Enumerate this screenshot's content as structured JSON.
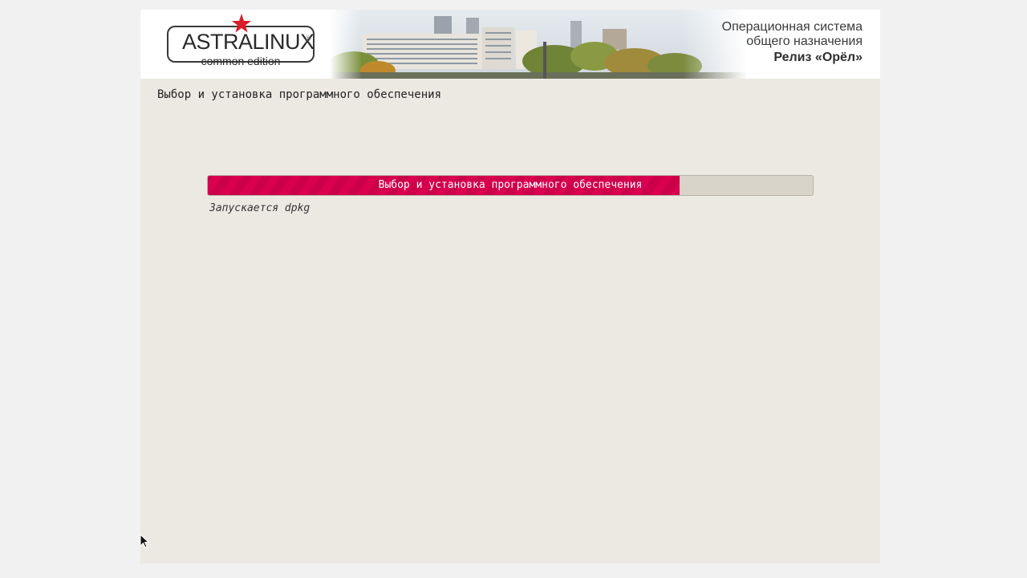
{
  "banner": {
    "logo_name": "ASTRALINUX",
    "logo_registered": "®",
    "logo_edition": "common edition",
    "os_line1": "Операционная система",
    "os_line2": "общего назначения",
    "release": "Релиз «Орёл»"
  },
  "step": {
    "title": "Выбор и установка программного обеспечения"
  },
  "progress": {
    "label": "Выбор и установка программного обеспечения",
    "fraction": 0.78
  },
  "status": {
    "text": "Запускается dpkg"
  },
  "icons": {
    "logo_star": "red-star-icon",
    "pointer": "mouse-pointer-icon"
  },
  "colors": {
    "progress_fill": "#d8004f",
    "progress_track": "#d9d4ca",
    "installer_bg": "#ece9e3",
    "star": "#d81e2a"
  }
}
